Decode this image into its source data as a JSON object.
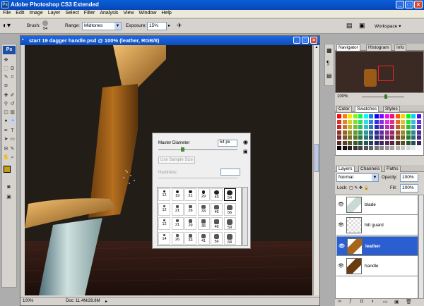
{
  "app": {
    "title": "Adobe Photoshop CS3 Extended",
    "logo": "Ps",
    "window_buttons": [
      "_",
      "□",
      "×"
    ]
  },
  "menu": [
    "File",
    "Edit",
    "Image",
    "Layer",
    "Select",
    "Filter",
    "Analysis",
    "View",
    "Window",
    "Help"
  ],
  "options_bar": {
    "brush_label": "Brush:",
    "brush_size": "54",
    "range_label": "Range:",
    "range_value": "Midtones",
    "exposure_label": "Exposure:",
    "exposure_value": "15%",
    "workspace_label": "Workspace ▾"
  },
  "document": {
    "title": "start 19 dagger handle.psd @ 100% (leather, RGB/8)",
    "zoom": "100%",
    "doc_info": "Doc: 11.4M/28.8M"
  },
  "brush_popup": {
    "master_diameter_label": "Master Diameter",
    "master_diameter_value": "54 px",
    "use_sample_size": "Use Sample Size",
    "hardness_label": "Hardness:",
    "master_diameter_fraction": 0.3,
    "brush_sizes": [
      [
        "12",
        "19",
        "21",
        "29",
        "43",
        "54"
      ],
      [
        "12",
        "21",
        "26",
        "33",
        "46",
        "56"
      ],
      [
        "12",
        "21",
        "29",
        "36",
        "46",
        "59"
      ],
      [
        "14",
        "26",
        "33",
        "41",
        "56",
        "68"
      ]
    ]
  },
  "navigator": {
    "tabs": [
      "Navigator",
      "Histogram",
      "Info"
    ],
    "zoom": "100%"
  },
  "swatches_panel": {
    "tabs": [
      "Color",
      "Swatches",
      "Styles"
    ]
  },
  "layers_panel": {
    "tabs": [
      "Layers",
      "Channels",
      "Paths"
    ],
    "blend_mode": "Normal",
    "opacity_label": "Opacity:",
    "opacity_value": "100%",
    "lock_label": "Lock:",
    "fill_label": "Fill:",
    "fill_value": "100%",
    "layers": [
      {
        "name": "blade",
        "selected": false
      },
      {
        "name": "hilt guard",
        "selected": false
      },
      {
        "name": "leather",
        "selected": true
      },
      {
        "name": "handle",
        "selected": false
      }
    ]
  }
}
